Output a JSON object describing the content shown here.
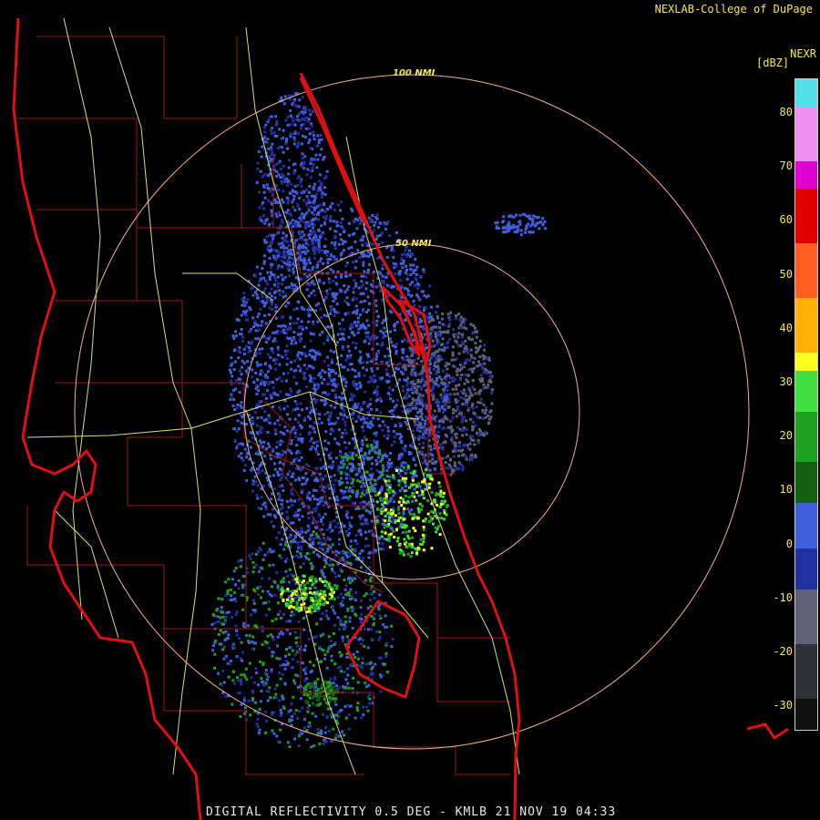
{
  "header": {
    "credit": "NEXLAB-College of DuPage",
    "product": "NEXR",
    "units": "[dBZ]"
  },
  "rings": [
    {
      "label": "100 NMI"
    },
    {
      "label": "50 NMI"
    }
  ],
  "footer": {
    "caption": "DIGITAL REFLECTIVITY 0.5 DEG - KMLB 21 NOV 19 04:33"
  },
  "legend": {
    "ticks": [
      "80",
      "70",
      "60",
      "50",
      "40",
      "30",
      "20",
      "10",
      "0",
      "-10",
      "-20",
      "-30"
    ],
    "colors": {
      "c80": "#50e0e8",
      "c70": "#f090f0",
      "c65": "#e000d0",
      "c60": "#e00000",
      "c50": "#ff6020",
      "c40": "#ffb000",
      "c30": "#ffff20",
      "c25": "#40e040",
      "c15": "#20a020",
      "c10": "#106010",
      "c5": "#4060e0",
      "c0": "#2030a0",
      "cm10": "#606078",
      "cm20": "#303038",
      "cm30": "#101010"
    }
  },
  "colors": {
    "coastline": "#e01010",
    "county": "#a01818",
    "road": "#d8e070",
    "ring": "#f0b090"
  }
}
